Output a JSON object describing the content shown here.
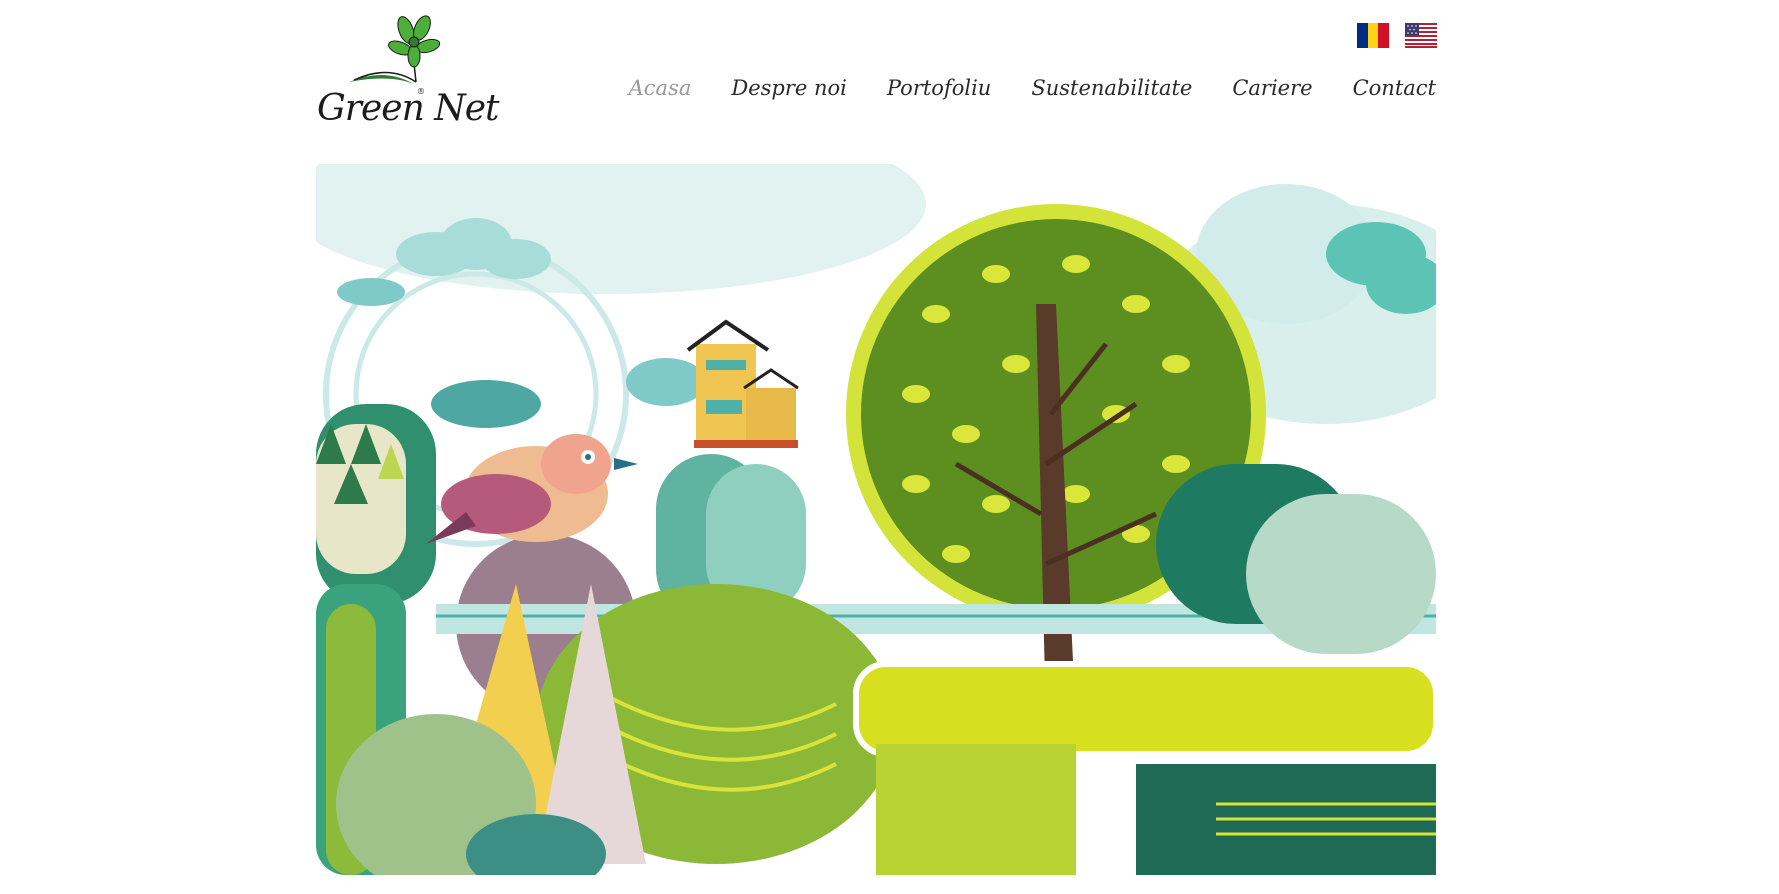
{
  "site": {
    "brand": "Green Net",
    "logo_icon": "green-flower-icon"
  },
  "languages": [
    {
      "code": "ro",
      "icon": "romania-flag-icon"
    },
    {
      "code": "en",
      "icon": "usa-flag-icon"
    }
  ],
  "nav": {
    "items": [
      {
        "label": "Acasa",
        "active": true
      },
      {
        "label": "Despre noi",
        "active": false
      },
      {
        "label": "Portofoliu",
        "active": false
      },
      {
        "label": "Sustenabilitate",
        "active": false
      },
      {
        "label": "Cariere",
        "active": false
      },
      {
        "label": "Contact",
        "active": false
      }
    ]
  },
  "hero": {
    "description": "illustration-nature-landscape"
  },
  "colors": {
    "active_nav": "#9a9a9a",
    "text": "#2a2a2a",
    "brand_green": "#4caf3a"
  }
}
